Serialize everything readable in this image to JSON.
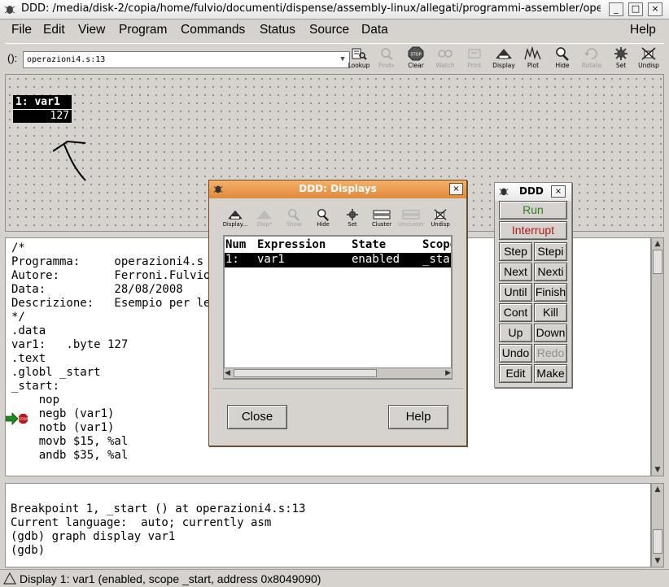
{
  "window": {
    "title": "DDD: /media/disk-2/copia/home/fulvio/documenti/dispense/assembly-linux/allegati/programmi-assembler/operazioni4.s",
    "minimize_label": "_",
    "maximize_label": "□",
    "close_label": "×"
  },
  "menubar": {
    "items": [
      "File",
      "Edit",
      "View",
      "Program",
      "Commands",
      "Status",
      "Source",
      "Data"
    ],
    "help": "Help"
  },
  "toolbar": {
    "arg_label": "():",
    "arg_value": "operazioni4.s:13",
    "tools": [
      "Lookup",
      "Find»",
      "Clear",
      "Watch",
      "Print",
      "Display",
      "Plot",
      "Hide",
      "Rotate",
      "Set",
      "Undisp"
    ]
  },
  "graph": {
    "node_title": "1: var1",
    "node_value": "127"
  },
  "source": {
    "lines": [
      "/*",
      "Programma:     operazioni4.s",
      "Autore:        Ferroni.Fulvio",
      "Data:          28/08/2008",
      "Descrizione:   Esempio per le istruzioni logiche e di negazione",
      "*/",
      ".data",
      "var1:   .byte 127",
      ".text",
      ".globl _start",
      "_start:",
      "    nop",
      "    negb (var1)",
      "    notb (var1)",
      "    movb $15, %al",
      "    andb $35, %al"
    ],
    "stop_label": "STOP"
  },
  "console": {
    "lines": [
      "",
      "Breakpoint 1, _start () at operazioni4.s:13",
      "Current language:  auto; currently asm",
      "(gdb) graph display var1",
      "(gdb)"
    ]
  },
  "status": {
    "text": "Display 1: var1 (enabled, scope _start, address 0x8049090)"
  },
  "displays_dialog": {
    "title": "DDD: Displays",
    "close_x": "×",
    "tools": [
      "Display...",
      "Disp*",
      "Show",
      "Hide",
      "Set",
      "Cluster",
      "Uncluster",
      "Undisp"
    ],
    "columns": [
      "Num",
      "Expression",
      "State",
      "Scope"
    ],
    "row": {
      "num": "1:",
      "expression": "var1",
      "state": "enabled",
      "scope": "_start"
    },
    "close_button": "Close",
    "help_button": "Help"
  },
  "command_tool": {
    "title": "DDD",
    "close_x": "×",
    "run": "Run",
    "interrupt": "Interrupt",
    "pairs": [
      [
        "Step",
        "Stepi"
      ],
      [
        "Next",
        "Nexti"
      ],
      [
        "Until",
        "Finish"
      ],
      [
        "Cont",
        "Kill"
      ],
      [
        "Up",
        "Down"
      ],
      [
        "Undo",
        "Redo"
      ],
      [
        "Edit",
        "Make"
      ]
    ],
    "colors": {
      "run": "#2e7d1f",
      "interrupt": "#b01818",
      "disabled": "#8f8f8f"
    }
  }
}
